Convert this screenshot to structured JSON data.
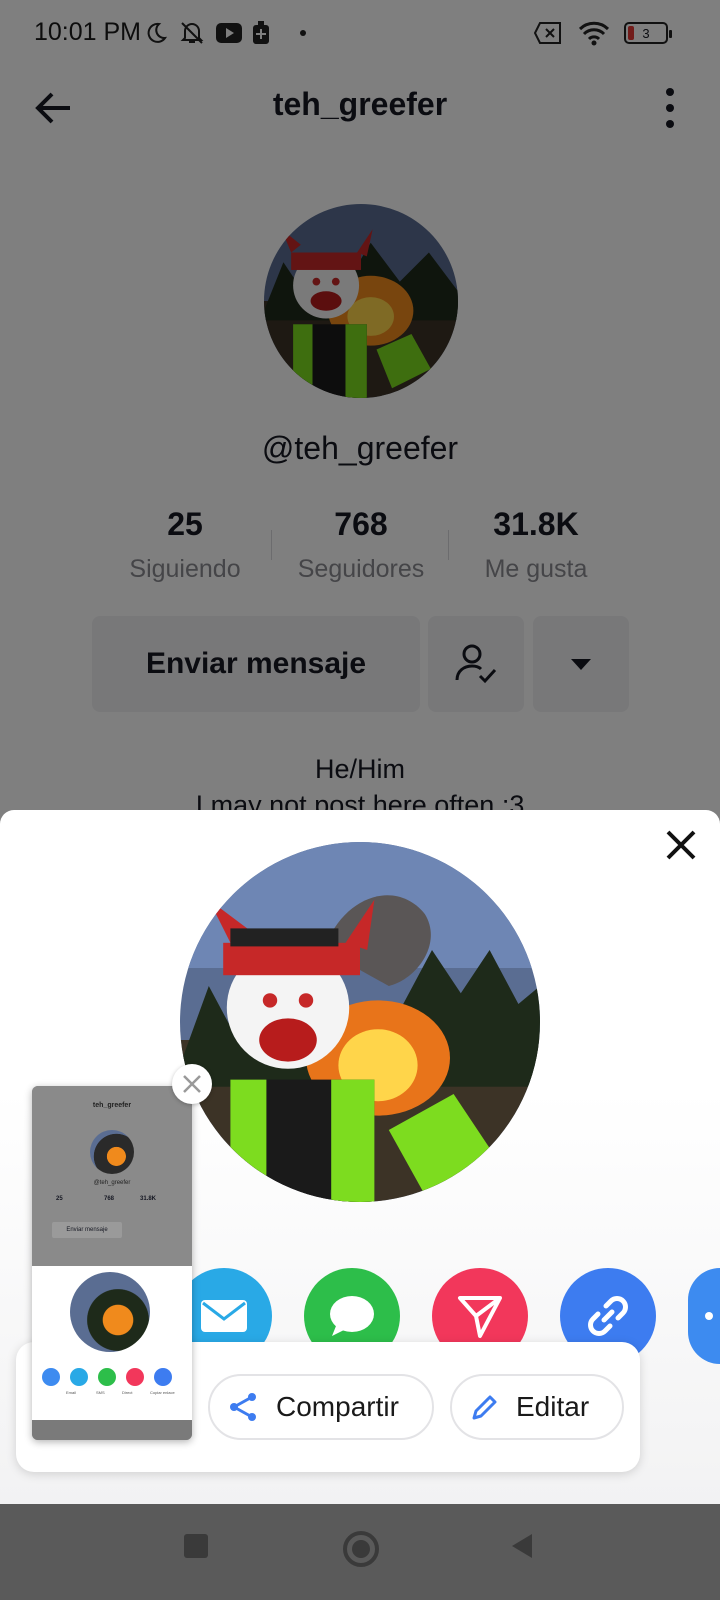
{
  "status": {
    "time": "10:01 PM",
    "battery": "3"
  },
  "header": {
    "title": "teh_greefer"
  },
  "profile": {
    "handle": "@teh_greefer",
    "stats": [
      {
        "value": "25",
        "label": "Siguiendo"
      },
      {
        "value": "768",
        "label": "Seguidores"
      },
      {
        "value": "31.8K",
        "label": "Me gusta"
      }
    ],
    "message_button": "Enviar mensaje",
    "bio_lines": [
      "He/Him",
      "I may not post here often :3"
    ]
  },
  "share_targets": [
    {
      "icon": "email-icon",
      "color": "#29A9E6"
    },
    {
      "icon": "sms-icon",
      "color": "#2DBE4A"
    },
    {
      "icon": "direct-icon",
      "color": "#F2375B"
    },
    {
      "icon": "link-icon",
      "color": "#3D7CF0"
    },
    {
      "icon": "more-icon",
      "color": "#3D8BF0"
    }
  ],
  "screenshot_preview": {
    "title": "teh_greefer",
    "handle": "@teh_greefer",
    "stats": [
      "25",
      "768",
      "31.8K"
    ],
    "button": "Enviar mensaje",
    "share_labels": [
      "Email",
      "SMS",
      "Direct",
      "Copiar enlace"
    ]
  },
  "actions": {
    "share": "Compartir",
    "edit": "Editar"
  },
  "colors": {
    "accent_red": "#FE2C55",
    "link_blue": "#3D7CF0"
  }
}
